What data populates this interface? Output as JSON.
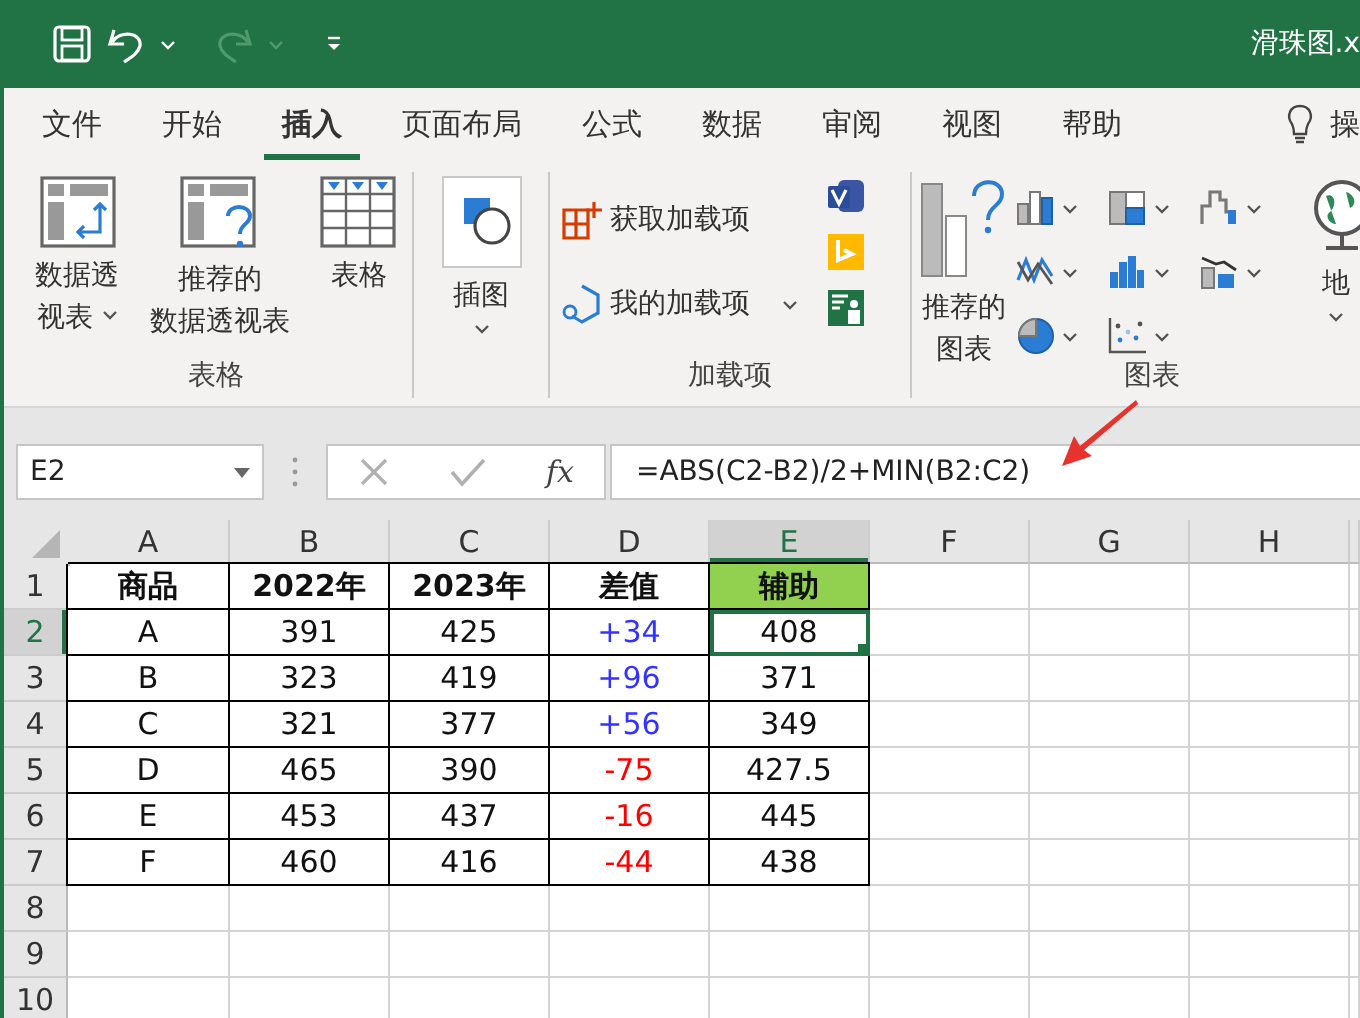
{
  "title_bar": {
    "title": "滑珠图.x",
    "redo": {
      "disabled": true
    }
  },
  "ribbon_tabs": [
    {
      "label": "文件",
      "selected": false
    },
    {
      "label": "开始",
      "selected": false
    },
    {
      "label": "插入",
      "selected": true
    },
    {
      "label": "页面布局",
      "selected": false
    },
    {
      "label": "公式",
      "selected": false
    },
    {
      "label": "数据",
      "selected": false
    },
    {
      "label": "审阅",
      "selected": false
    },
    {
      "label": "视图",
      "selected": false
    },
    {
      "label": "帮助",
      "selected": false
    }
  ],
  "tell_me": "操",
  "ribbon": {
    "groups": [
      {
        "kind": "tables",
        "label": "表格",
        "buttons": [
          {
            "label_lines": [
              "数据透",
              "视表"
            ],
            "dropdown": true
          },
          {
            "label_lines": [
              "推荐的",
              "数据透视表"
            ],
            "dropdown": false
          },
          {
            "label_lines": [
              "表格"
            ],
            "dropdown": false
          }
        ]
      },
      {
        "kind": "illustrations",
        "buttons": [
          {
            "label_lines": [
              "插图"
            ],
            "dropdown": true
          }
        ]
      },
      {
        "kind": "addins",
        "label": "加载项",
        "buttons": [
          {
            "label": "获取加载项",
            "dropdown": false
          },
          {
            "label": "我的加载项",
            "dropdown": true
          }
        ]
      },
      {
        "kind": "charts",
        "label": "图表",
        "buttons": [
          {
            "label_lines": [
              "推荐的",
              "图表"
            ],
            "dropdown": false
          },
          {
            "label_lines": [
              "地"
            ],
            "dropdown": true
          }
        ]
      }
    ]
  },
  "formula_bar": {
    "name_box": "E2",
    "function_button": "fx",
    "formula": "=ABS(C2-B2)/2+MIN(B2:C2)"
  },
  "sheet": {
    "columns": [
      {
        "label": "A",
        "selected": false
      },
      {
        "label": "B",
        "selected": false
      },
      {
        "label": "C",
        "selected": false
      },
      {
        "label": "D",
        "selected": false
      },
      {
        "label": "E",
        "selected": true
      },
      {
        "label": "F",
        "selected": false
      },
      {
        "label": "G",
        "selected": false
      },
      {
        "label": "H",
        "selected": false
      }
    ],
    "rows": [
      {
        "label": "1",
        "selected": false,
        "kind": "header",
        "cells": [
          {
            "text": "商品",
            "selected": false
          },
          {
            "text": "2022年",
            "selected": false
          },
          {
            "text": "2023年",
            "selected": false
          },
          {
            "text": "差值",
            "selected": false
          },
          {
            "text": "辅助",
            "selected": false,
            "highlighted": true
          }
        ]
      },
      {
        "label": "2",
        "selected": true,
        "kind": "data",
        "cells": [
          {
            "text": "A",
            "selected": false
          },
          {
            "text": "391",
            "selected": false
          },
          {
            "text": "425",
            "selected": false
          },
          {
            "text": "+34",
            "selected": false,
            "color": "#3333ff"
          },
          {
            "text": "408",
            "selected": true
          }
        ]
      },
      {
        "label": "3",
        "selected": false,
        "kind": "data",
        "cells": [
          {
            "text": "B",
            "selected": false
          },
          {
            "text": "323",
            "selected": false
          },
          {
            "text": "419",
            "selected": false
          },
          {
            "text": "+96",
            "selected": false,
            "color": "#3333ff"
          },
          {
            "text": "371",
            "selected": false
          }
        ]
      },
      {
        "label": "4",
        "selected": false,
        "kind": "data",
        "cells": [
          {
            "text": "C",
            "selected": false
          },
          {
            "text": "321",
            "selected": false
          },
          {
            "text": "377",
            "selected": false
          },
          {
            "text": "+56",
            "selected": false,
            "color": "#3333ff"
          },
          {
            "text": "349",
            "selected": false
          }
        ]
      },
      {
        "label": "5",
        "selected": false,
        "kind": "data",
        "cells": [
          {
            "text": "D",
            "selected": false
          },
          {
            "text": "465",
            "selected": false
          },
          {
            "text": "390",
            "selected": false
          },
          {
            "text": "-75",
            "selected": false,
            "color": "#ff0000"
          },
          {
            "text": "427.5",
            "selected": false
          }
        ]
      },
      {
        "label": "6",
        "selected": false,
        "kind": "data",
        "cells": [
          {
            "text": "E",
            "selected": false
          },
          {
            "text": "453",
            "selected": false
          },
          {
            "text": "437",
            "selected": false
          },
          {
            "text": "-16",
            "selected": false,
            "color": "#ff0000"
          },
          {
            "text": "445",
            "selected": false
          }
        ]
      },
      {
        "label": "7",
        "selected": false,
        "kind": "data",
        "cells": [
          {
            "text": "F",
            "selected": false
          },
          {
            "text": "460",
            "selected": false
          },
          {
            "text": "416",
            "selected": false
          },
          {
            "text": "-44",
            "selected": false,
            "color": "#ff0000"
          },
          {
            "text": "438",
            "selected": false
          }
        ]
      },
      {
        "label": "8",
        "selected": false,
        "kind": "empty"
      },
      {
        "label": "9",
        "selected": false,
        "kind": "empty"
      },
      {
        "label": "10",
        "selected": false,
        "kind": "empty"
      }
    ]
  }
}
